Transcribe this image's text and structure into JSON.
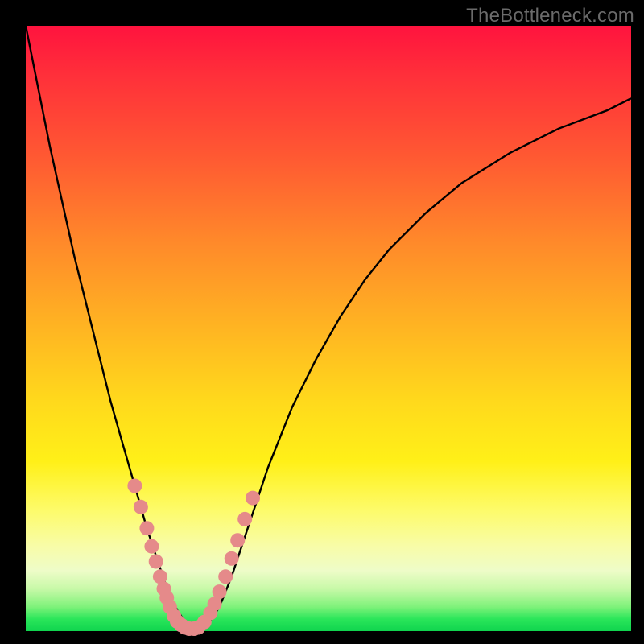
{
  "watermark": "TheBottleneck.com",
  "colors": {
    "frame": "#000000",
    "curve_stroke": "#000000",
    "dot_fill": "#e58a8a",
    "gradient_top": "#ff133e",
    "gradient_bottom": "#0fd44e"
  },
  "chart_data": {
    "type": "line",
    "title": "",
    "xlabel": "",
    "ylabel": "",
    "xlim": [
      0,
      100
    ],
    "ylim": [
      0,
      100
    ],
    "x": [
      0,
      2,
      4,
      6,
      8,
      10,
      12,
      14,
      16,
      18,
      20,
      22,
      23,
      24,
      25,
      26,
      27,
      28,
      29,
      30,
      32,
      34,
      36,
      38,
      40,
      44,
      48,
      52,
      56,
      60,
      66,
      72,
      80,
      88,
      96,
      100
    ],
    "values": [
      100,
      90,
      80,
      71,
      62,
      54,
      46,
      38,
      31,
      24,
      17,
      11,
      8,
      5.5,
      3.5,
      2,
      1,
      0.4,
      0.4,
      1,
      4,
      9,
      15,
      21,
      27,
      37,
      45,
      52,
      58,
      63,
      69,
      74,
      79,
      83,
      86,
      88
    ],
    "highlighted_points": {
      "comment": "pink markers clustered near the valley on both branches",
      "x": [
        18,
        19,
        20,
        20.8,
        21.5,
        22.2,
        22.8,
        23.3,
        23.8,
        24.5,
        25,
        25.7,
        26.3,
        27,
        27.8,
        28.5,
        29.5,
        30.5,
        31.2,
        32,
        33,
        34,
        35,
        36.2,
        37.5
      ],
      "y": [
        24,
        20.5,
        17,
        14,
        11.5,
        9,
        7,
        5.5,
        4,
        2.5,
        1.6,
        1,
        0.6,
        0.4,
        0.4,
        0.6,
        1.5,
        3,
        4.5,
        6.5,
        9,
        12,
        15,
        18.5,
        22
      ]
    }
  }
}
